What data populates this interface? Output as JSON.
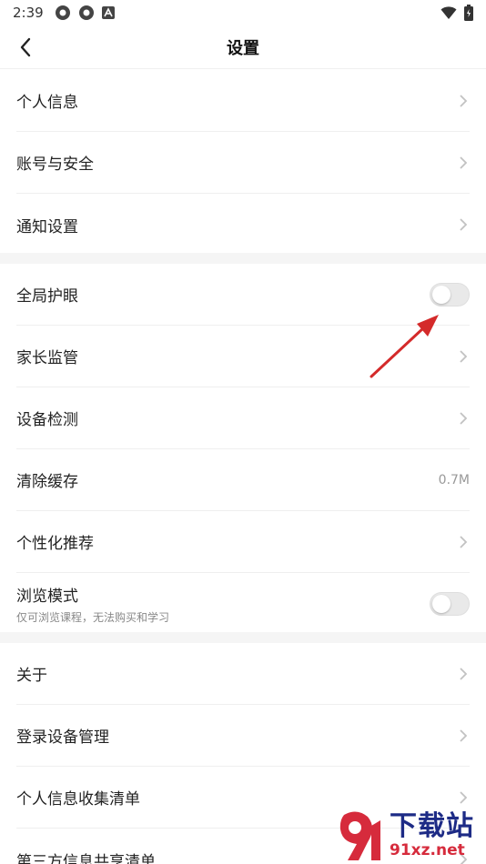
{
  "status_bar": {
    "time": "2:39"
  },
  "header": {
    "title": "设置"
  },
  "groups": [
    {
      "items": [
        {
          "label": "个人信息"
        },
        {
          "label": "账号与安全"
        },
        {
          "label": "通知设置"
        }
      ]
    },
    {
      "items": [
        {
          "label": "全局护眼",
          "toggle": false
        },
        {
          "label": "家长监管"
        },
        {
          "label": "设备检测"
        },
        {
          "label": "清除缓存",
          "value": "0.7M"
        },
        {
          "label": "个性化推荐"
        },
        {
          "label": "浏览模式",
          "sub": "仅可浏览课程，无法购买和学习",
          "toggle": false
        }
      ]
    },
    {
      "items": [
        {
          "label": "关于"
        },
        {
          "label": "登录设备管理"
        },
        {
          "label": "个人信息收集清单"
        },
        {
          "label": "第三方信息共享清单"
        }
      ]
    }
  ],
  "watermark": {
    "brand": "下载站",
    "site": "91xz.net"
  },
  "colors": {
    "annotation_arrow": "#d42a2a",
    "section_gap": "#f5f5f5",
    "watermark_blue": "#1d2b86",
    "watermark_red": "#d62b3c"
  }
}
